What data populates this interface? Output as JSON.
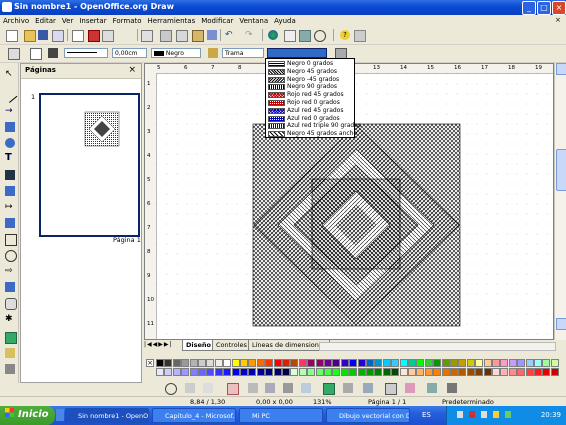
{
  "window": {
    "title": "Sin nombre1 - OpenOffice.org Draw"
  },
  "menu": [
    "Archivo",
    "Editar",
    "Ver",
    "Insertar",
    "Formato",
    "Herramientas",
    "Modificar",
    "Ventana",
    "Ayuda"
  ],
  "line_toolbar": {
    "line_width": "0,00cm",
    "line_color": "Negro",
    "area_style": "Trama"
  },
  "pages_panel": {
    "title": "Páginas",
    "page_number": "1",
    "page_label": "Página 1"
  },
  "ruler_ticks": [
    "5",
    "6",
    "7",
    "8",
    "9",
    "10",
    "11",
    "12",
    "13",
    "14",
    "15",
    "16",
    "17",
    "18",
    "19"
  ],
  "vruler_ticks": [
    "1",
    "2",
    "3",
    "4",
    "5",
    "6",
    "7",
    "8",
    "9",
    "10",
    "11"
  ],
  "hatch_options": [
    {
      "label": "Negro 0 grados",
      "color": "#000000",
      "pattern": "h"
    },
    {
      "label": "Negro 45 grados",
      "color": "#000000",
      "pattern": "d"
    },
    {
      "label": "Negro -45 grados",
      "color": "#000000",
      "pattern": "a"
    },
    {
      "label": "Negro 90 grados",
      "color": "#000000",
      "pattern": "v"
    },
    {
      "label": "Rojo red 45 grados",
      "color": "#c00000",
      "pattern": "x"
    },
    {
      "label": "Rojo red 0 grados",
      "color": "#c00000",
      "pattern": "g"
    },
    {
      "label": "Azul red 45 grados",
      "color": "#0000c0",
      "pattern": "x"
    },
    {
      "label": "Azul red 0 grados",
      "color": "#0000c0",
      "pattern": "g"
    },
    {
      "label": "Azul red triple 90 grados",
      "color": "#0000c0",
      "pattern": "v"
    },
    {
      "label": "Negro 45 grados ancho",
      "color": "#000000",
      "pattern": "w"
    }
  ],
  "tabs": [
    "Diseño",
    "Controles",
    "Líneas de dimensiones"
  ],
  "status": {
    "position": "8,84 / 1,30",
    "size": "0,00 x 0,00",
    "zoom": "131%",
    "page": "Página 1 / 1",
    "style": "Predeterminado"
  },
  "taskbar": {
    "start": "Inicio",
    "tasks": [
      "Sin nombre1 - OpenO...",
      "Capitulo_4 - Microsof...",
      "Mi PC",
      "Dibujo vectorial con D..."
    ],
    "lang": "ES",
    "clock": "20:39"
  },
  "palette": [
    "#000000",
    "#333333",
    "#666666",
    "#999999",
    "#b3b3b3",
    "#cccccc",
    "#dddddd",
    "#eeeeee",
    "#ffffff",
    "#ffff00",
    "#ffcc00",
    "#ff9900",
    "#ff6600",
    "#ff3300",
    "#ff0000",
    "#dc2300",
    "#b84700",
    "#ff3366",
    "#990066",
    "#94006b",
    "#6b0094",
    "#4b0082",
    "#3300cc",
    "#0000ff",
    "#2300dc",
    "#0066cc",
    "#0099cc",
    "#00ccff",
    "#33ccff",
    "#00ffff",
    "#00cc99",
    "#00ff00",
    "#33cc33",
    "#009900",
    "#669900",
    "#999900",
    "#cc9900",
    "#cccc00",
    "#ffff99",
    "#ffcc99",
    "#ff9999",
    "#ff99cc",
    "#cc99ff",
    "#9999ff",
    "#99ccff",
    "#99ffff",
    "#99ff99",
    "#ccff99"
  ],
  "palette2": [
    "#e6e6ff",
    "#ccccff",
    "#b3b3ff",
    "#9999ff",
    "#8080ff",
    "#6666ff",
    "#4d4dff",
    "#3333ff",
    "#1a1aff",
    "#0000e6",
    "#0000cc",
    "#0000b3",
    "#000099",
    "#000080",
    "#000066",
    "#00004d",
    "#d9ffd9",
    "#b3ffb3",
    "#8cff8c",
    "#66ff66",
    "#40ff40",
    "#1aff1a",
    "#00e600",
    "#00cc00",
    "#00b300",
    "#009900",
    "#008000",
    "#006600",
    "#004d00",
    "#ffe6cc",
    "#ffcc99",
    "#ffb366",
    "#ff9933",
    "#ff8000",
    "#e67300",
    "#cc6600",
    "#b35900",
    "#994d00",
    "#804000",
    "#663300",
    "#ffd9d9",
    "#ffb3b3",
    "#ff8c8c",
    "#ff6666",
    "#ff4040",
    "#ff1a1a",
    "#e60000",
    "#cc0000"
  ]
}
